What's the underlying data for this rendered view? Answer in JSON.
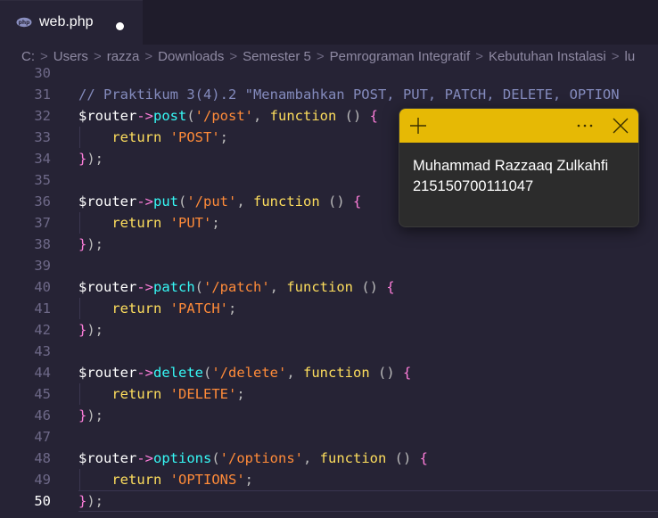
{
  "tab": {
    "filename": "web.php",
    "dirty": true
  },
  "breadcrumb": {
    "items": [
      "C:",
      "Users",
      "razza",
      "Downloads",
      "Semester 5",
      "Pemrograman Integratif",
      "Kebutuhan Instalasi",
      "lu"
    ]
  },
  "colors": {
    "background": "#262335",
    "accent": "#e6b905",
    "keyword": "#fede5d",
    "string": "#ff8b39",
    "method": "#36f9f6",
    "arrow": "#ff7edb"
  },
  "editor": {
    "current_line": 50,
    "lines": [
      {
        "num": "30",
        "code": ""
      },
      {
        "num": "31",
        "comment": "// Praktikum 3(4).2 \"Menambahkan POST, PUT, PATCH, DELETE, OPTION"
      },
      {
        "num": "32",
        "method": "post",
        "path": "'/post'"
      },
      {
        "num": "33",
        "ret": "'POST'"
      },
      {
        "num": "34",
        "close": "});"
      },
      {
        "num": "35",
        "code": ""
      },
      {
        "num": "36",
        "method": "put",
        "path": "'/put'"
      },
      {
        "num": "37",
        "ret": "'PUT'"
      },
      {
        "num": "38",
        "close": "});"
      },
      {
        "num": "39",
        "code": ""
      },
      {
        "num": "40",
        "method": "patch",
        "path": "'/patch'"
      },
      {
        "num": "41",
        "ret": "'PATCH'"
      },
      {
        "num": "42",
        "close": "});"
      },
      {
        "num": "43",
        "code": ""
      },
      {
        "num": "44",
        "method": "delete",
        "path": "'/delete'"
      },
      {
        "num": "45",
        "ret": "'DELETE'"
      },
      {
        "num": "46",
        "close": "});"
      },
      {
        "num": "47",
        "code": ""
      },
      {
        "num": "48",
        "method": "options",
        "path": "'/options'"
      },
      {
        "num": "49",
        "ret": "'OPTIONS'"
      },
      {
        "num": "50",
        "close": "});"
      }
    ],
    "tokens": {
      "router": "$router",
      "arrow": "->",
      "function_kw": "function",
      "return_kw": "return"
    }
  },
  "sticky_note": {
    "lines": [
      "Muhammad Razzaaq Zulkahfi",
      "215150700111047"
    ],
    "icons": [
      "plus-icon",
      "more-icon",
      "close-icon"
    ]
  }
}
